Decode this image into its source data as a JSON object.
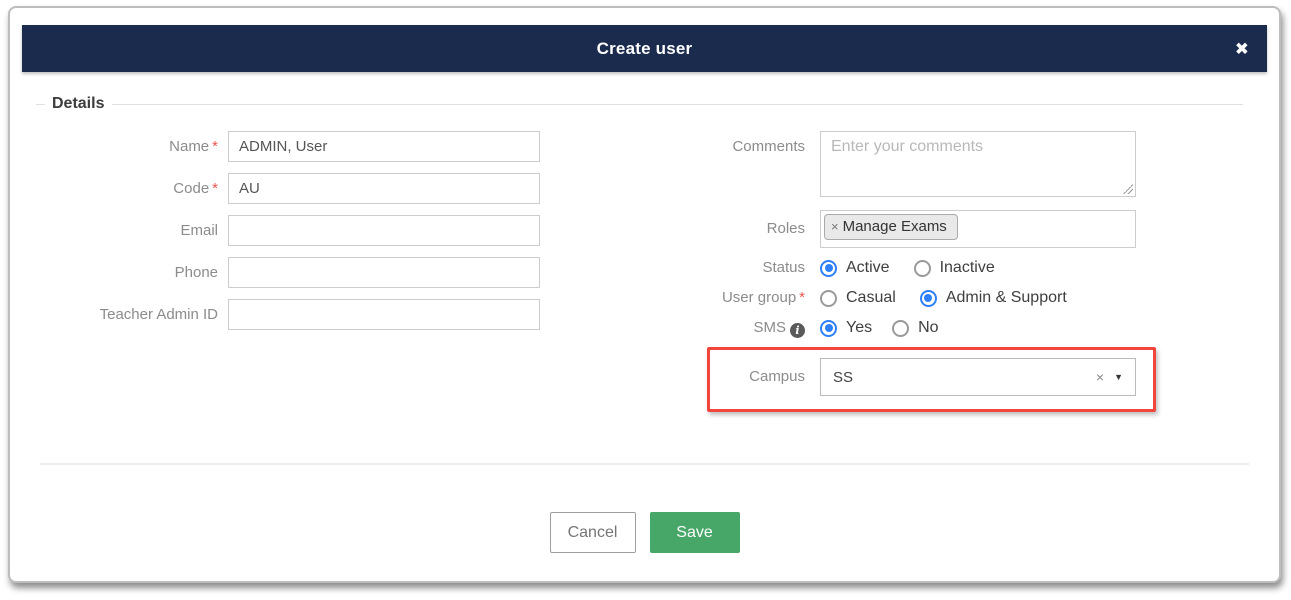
{
  "colors": {
    "header_bg": "#1b2b4e",
    "save_green": "#47a768",
    "annotation_red": "#f2453c",
    "radio_blue": "#2d80f7"
  },
  "modal": {
    "title": "Create user",
    "close_icon": "✖"
  },
  "details": {
    "legend": "Details"
  },
  "fields": {
    "name": {
      "label": "Name",
      "required_marker": "*",
      "value": "ADMIN, User"
    },
    "code": {
      "label": "Code",
      "required_marker": "*",
      "value": "AU"
    },
    "email": {
      "label": "Email",
      "value": ""
    },
    "phone": {
      "label": "Phone",
      "value": ""
    },
    "teacher_admin_id": {
      "label": "Teacher Admin ID",
      "value": ""
    },
    "comments": {
      "label": "Comments",
      "placeholder": "Enter your comments",
      "value": ""
    },
    "roles": {
      "label": "Roles",
      "tags": [
        {
          "remove_icon": "×",
          "label": "Manage Exams"
        }
      ]
    },
    "status": {
      "label": "Status",
      "options": [
        {
          "label": "Active",
          "selected": true
        },
        {
          "label": "Inactive",
          "selected": false
        }
      ]
    },
    "user_group": {
      "label": "User group",
      "required_marker": "*",
      "options": [
        {
          "label": "Casual",
          "selected": false
        },
        {
          "label": "Admin & Support",
          "selected": true
        }
      ]
    },
    "sms": {
      "label": "SMS",
      "info_icon": "i",
      "options": [
        {
          "label": "Yes",
          "selected": true
        },
        {
          "label": "No",
          "selected": false
        }
      ]
    },
    "campus": {
      "label": "Campus",
      "value": "SS",
      "clear_icon": "×",
      "caret_icon": "▼"
    }
  },
  "footer": {
    "cancel_label": "Cancel",
    "save_label": "Save"
  }
}
